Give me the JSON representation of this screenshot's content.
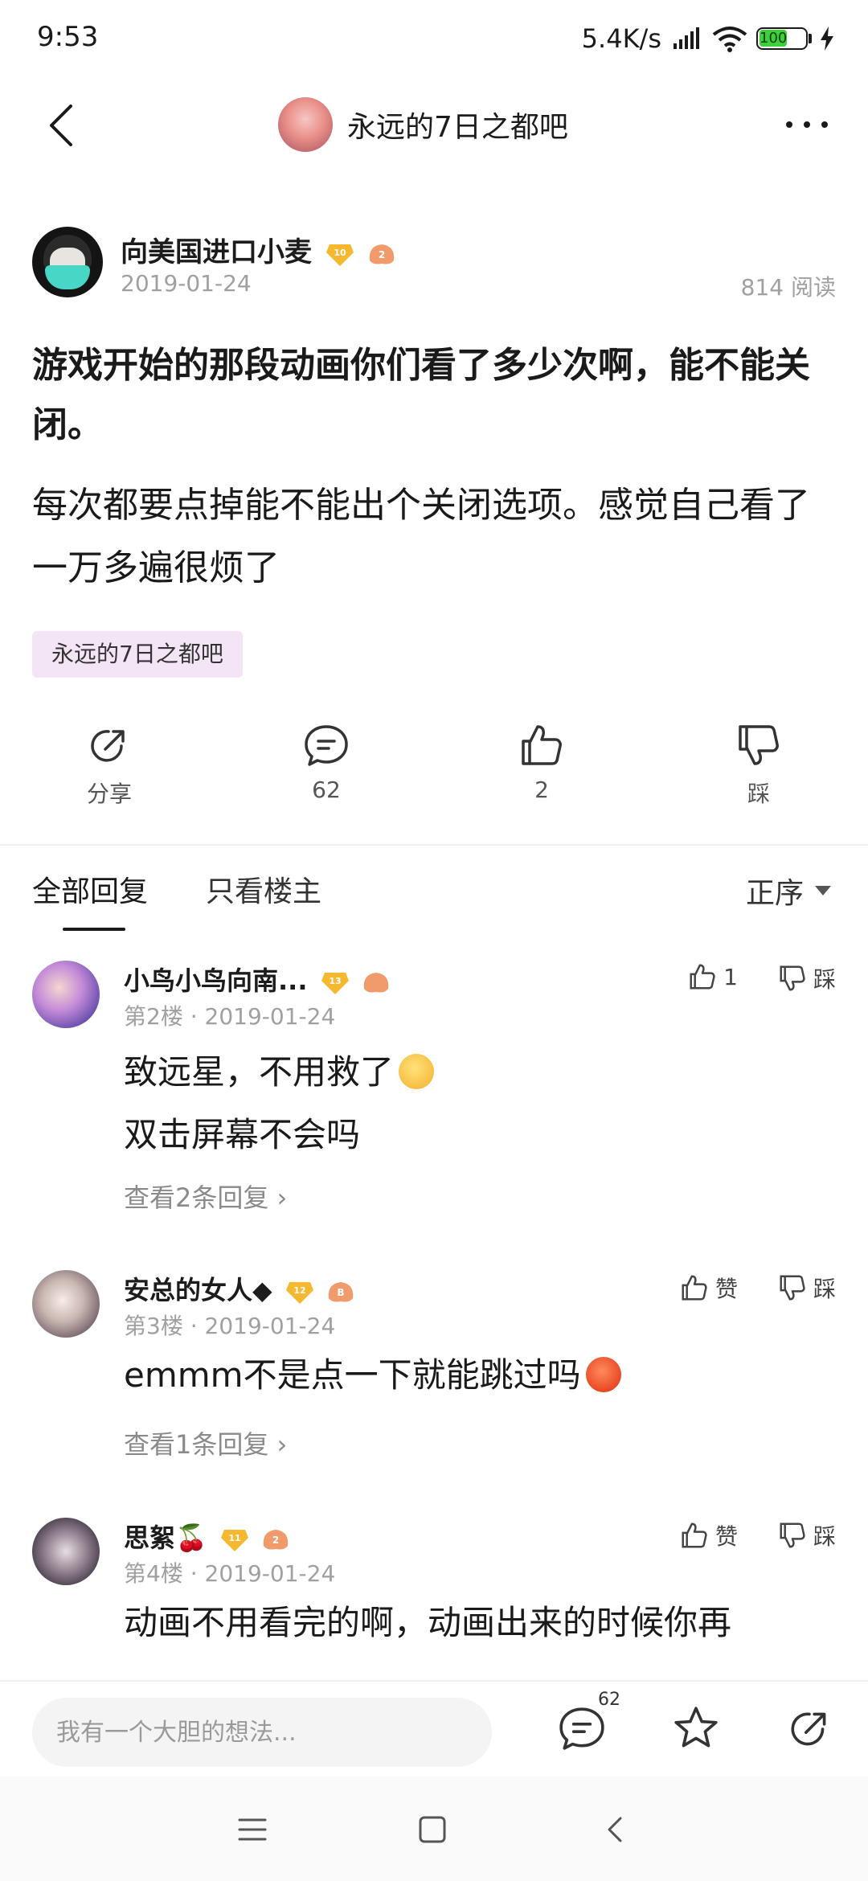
{
  "status_bar": {
    "time": "9:53",
    "net_speed": "5.4K/s",
    "battery": "100"
  },
  "header": {
    "forum_name": "永远的7日之都吧",
    "icons": [
      "back-icon",
      "more-icon"
    ]
  },
  "post": {
    "author": {
      "name": "向美国进口小麦",
      "level": "10",
      "medal": "2",
      "date": "2019-01-24"
    },
    "read_count": "814 阅读",
    "title": "游戏开始的那段动画你们看了多少次啊，能不能关闭。",
    "body": "每次都要点掉能不能出个关闭选项。感觉自己看了一万多遍很烦了",
    "tag": "永远的7日之都吧"
  },
  "actions": {
    "share": "分享",
    "comments": "62",
    "likes": "2",
    "dislike": "踩"
  },
  "tabs": {
    "all": "全部回复",
    "owner_only": "只看楼主",
    "sort": "正序"
  },
  "comments": [
    {
      "name": "小鸟小鸟向南...",
      "level": "13",
      "floor": "第2楼",
      "date": "2019-01-24",
      "like": "1",
      "dislike": "踩",
      "line1": "致远星，不用救了",
      "line2": "双击屏幕不会吗",
      "replies": "查看2条回复 ›"
    },
    {
      "name": "安总的女人◆",
      "level": "12",
      "medal": "B",
      "floor": "第3楼",
      "date": "2019-01-24",
      "like": "赞",
      "dislike": "踩",
      "line1": "emmm不是点一下就能跳过吗",
      "replies": "查看1条回复 ›"
    },
    {
      "name": "思絮🍒",
      "level": "11",
      "medal": "2",
      "floor": "第4楼",
      "date": "2019-01-24",
      "like": "赞",
      "dislike": "踩",
      "line1": "动画不用看完的啊，动画出来的时候你再"
    }
  ],
  "bottom_bar": {
    "placeholder": "我有一个大胆的想法...",
    "comment_count": "62"
  },
  "colors": {
    "tag_bg": "#f3e5f5",
    "meta_text": "#a0a0a0",
    "level_badge": "#f5b82e",
    "medal": "#f19a6b"
  }
}
